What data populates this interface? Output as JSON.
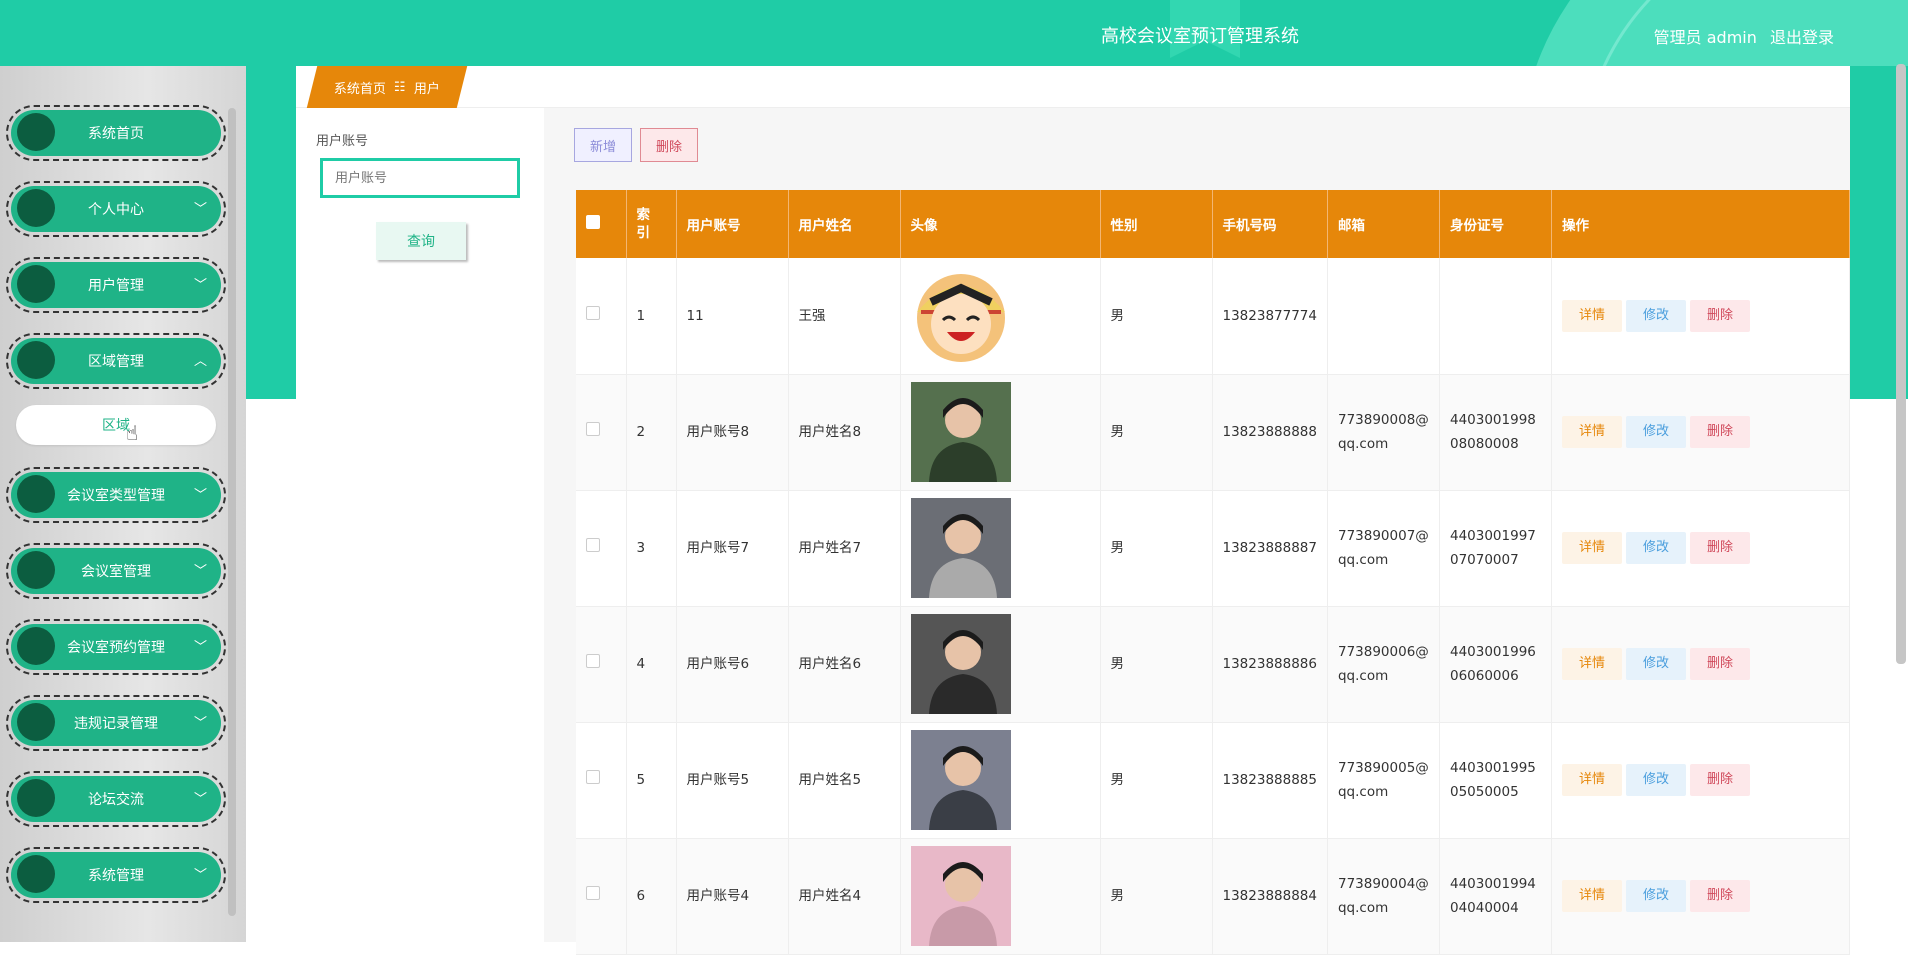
{
  "header": {
    "title": "高校会议室预订管理系统",
    "user_label": "管理员 admin",
    "logout_label": "退出登录"
  },
  "sidebar": {
    "items": [
      {
        "label": "系统首页",
        "has_chevron": false
      },
      {
        "label": "个人中心",
        "has_chevron": true
      },
      {
        "label": "用户管理",
        "has_chevron": true
      },
      {
        "label": "区域管理",
        "has_chevron": true,
        "expanded": true
      },
      {
        "label": "会议室类型管理",
        "has_chevron": true
      },
      {
        "label": "会议室管理",
        "has_chevron": true
      },
      {
        "label": "会议室预约管理",
        "has_chevron": true
      },
      {
        "label": "违规记录管理",
        "has_chevron": true
      },
      {
        "label": "论坛交流",
        "has_chevron": true
      },
      {
        "label": "系统管理",
        "has_chevron": true
      }
    ],
    "submenu_label": "区域"
  },
  "breadcrumb": {
    "home": "系统首页",
    "separator": "☷",
    "current": "用户"
  },
  "search": {
    "label": "用户账号",
    "placeholder": "用户账号",
    "button": "查询"
  },
  "toolbar": {
    "add_label": "新增",
    "delete_label": "删除"
  },
  "table": {
    "headers": [
      "索引",
      "用户账号",
      "用户姓名",
      "头像",
      "性别",
      "手机号码",
      "邮箱",
      "身份证号",
      "操作"
    ],
    "index_header": "索\n引",
    "actions": {
      "detail": "详情",
      "edit": "修改",
      "delete": "删除"
    },
    "rows": [
      {
        "index": "1",
        "account": "11",
        "name": "王强",
        "gender": "男",
        "phone": "13823877774",
        "email": "",
        "idcard": "",
        "avatar": "cartoon"
      },
      {
        "index": "2",
        "account": "用户账号8",
        "name": "用户姓名8",
        "gender": "男",
        "phone": "13823888888",
        "email": "773890008@qq.com",
        "idcard": "440300199808080008",
        "avatar": "photo"
      },
      {
        "index": "3",
        "account": "用户账号7",
        "name": "用户姓名7",
        "gender": "男",
        "phone": "13823888887",
        "email": "773890007@qq.com",
        "idcard": "440300199707070007",
        "avatar": "photo"
      },
      {
        "index": "4",
        "account": "用户账号6",
        "name": "用户姓名6",
        "gender": "男",
        "phone": "13823888886",
        "email": "773890006@qq.com",
        "idcard": "440300199606060006",
        "avatar": "photo"
      },
      {
        "index": "5",
        "account": "用户账号5",
        "name": "用户姓名5",
        "gender": "男",
        "phone": "13823888885",
        "email": "773890005@qq.com",
        "idcard": "440300199505050005",
        "avatar": "photo"
      },
      {
        "index": "6",
        "account": "用户账号4",
        "name": "用户姓名4",
        "gender": "男",
        "phone": "13823888884",
        "email": "773890004@qq.com",
        "idcard": "440300199404040004",
        "avatar": "photo"
      }
    ]
  },
  "colors": {
    "accent": "#1fcca6",
    "menu": "#1fb387",
    "table_header": "#e6870a"
  }
}
